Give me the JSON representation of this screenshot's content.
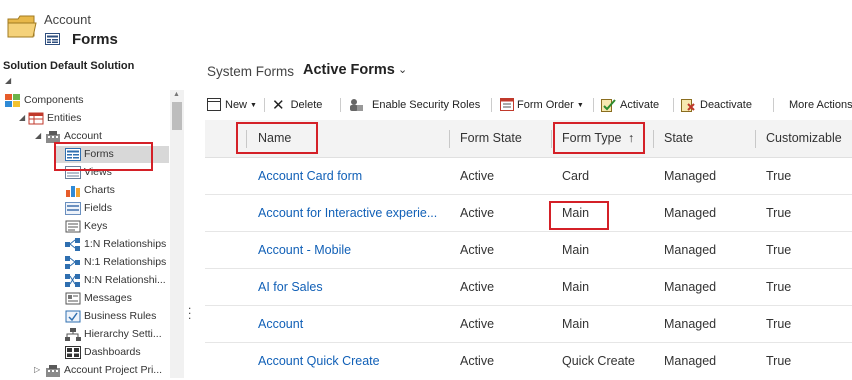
{
  "header": {
    "entity": "Account",
    "title": "Forms"
  },
  "nav": {
    "solution_label": "Solution Default Solution",
    "items": [
      {
        "label": "Components",
        "icon": "components-icon"
      },
      {
        "label": "Entities",
        "icon": "entities-icon"
      },
      {
        "label": "Account",
        "icon": "account-entity-icon"
      },
      {
        "label": "Forms",
        "icon": "forms-icon"
      },
      {
        "label": "Views",
        "icon": "views-icon"
      },
      {
        "label": "Charts",
        "icon": "charts-icon"
      },
      {
        "label": "Fields",
        "icon": "fields-icon"
      },
      {
        "label": "Keys",
        "icon": "keys-icon"
      },
      {
        "label": "1:N Relationships",
        "icon": "relationship-icon"
      },
      {
        "label": "N:1 Relationships",
        "icon": "relationship-icon"
      },
      {
        "label": "N:N Relationshi...",
        "icon": "relationship-icon"
      },
      {
        "label": "Messages",
        "icon": "messages-icon"
      },
      {
        "label": "Business Rules",
        "icon": "business-rules-icon"
      },
      {
        "label": "Hierarchy Setti...",
        "icon": "hierarchy-icon"
      },
      {
        "label": "Dashboards",
        "icon": "dashboards-icon"
      },
      {
        "label": "Account Project Pri...",
        "icon": "account-entity-icon"
      }
    ]
  },
  "main": {
    "breadcrumb": "System Forms",
    "view_title": "Active Forms",
    "toolbar": {
      "new": "New",
      "delete": "Delete",
      "security": "Enable Security Roles",
      "form_order": "Form Order",
      "activate": "Activate",
      "deactivate": "Deactivate",
      "more": "More Actions"
    },
    "columns": {
      "name": "Name",
      "form_state": "Form State",
      "form_type": "Form Type",
      "state": "State",
      "customizable": "Customizable"
    },
    "rows": [
      {
        "name": "Account Card form",
        "form_state": "Active",
        "form_type": "Card",
        "state": "Managed",
        "customizable": "True"
      },
      {
        "name": "Account for Interactive experie...",
        "form_state": "Active",
        "form_type": "Main",
        "state": "Managed",
        "customizable": "True"
      },
      {
        "name": "Account - Mobile",
        "form_state": "Active",
        "form_type": "Main",
        "state": "Managed",
        "customizable": "True"
      },
      {
        "name": "AI for Sales",
        "form_state": "Active",
        "form_type": "Main",
        "state": "Managed",
        "customizable": "True"
      },
      {
        "name": "Account",
        "form_state": "Active",
        "form_type": "Main",
        "state": "Managed",
        "customizable": "True"
      },
      {
        "name": "Account Quick Create",
        "form_state": "Active",
        "form_type": "Quick Create",
        "state": "Managed",
        "customizable": "True"
      }
    ]
  },
  "colors": {
    "link": "#1160b7",
    "highlight": "#d42027",
    "selected": "#d8d8d8"
  }
}
